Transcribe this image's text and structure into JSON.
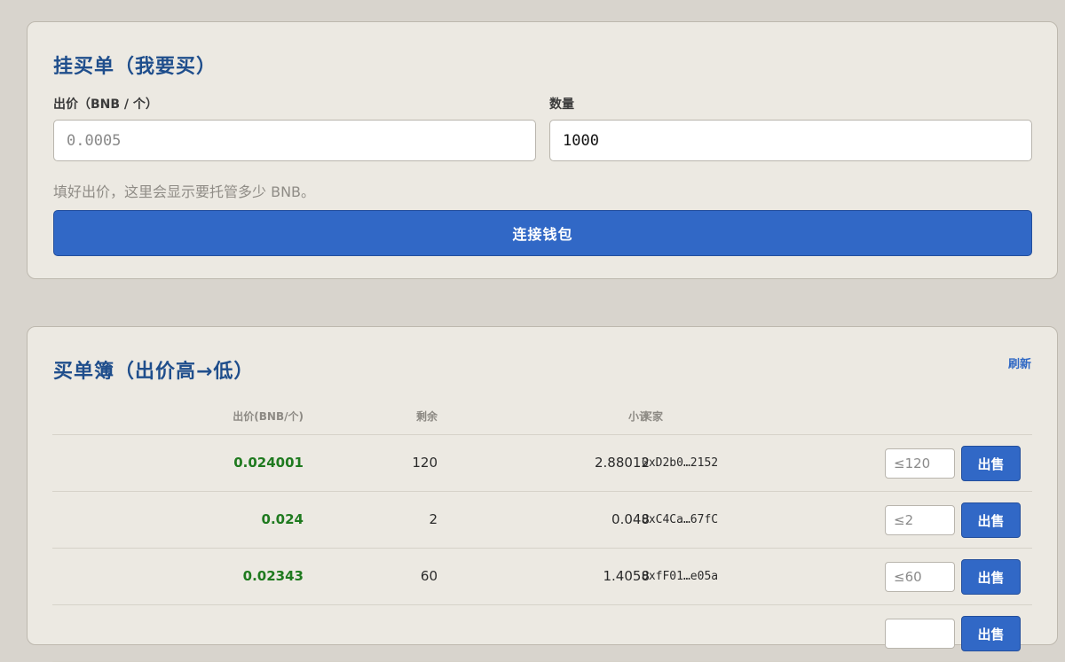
{
  "buy_order": {
    "title": "挂买单（我要买）",
    "price_label": "出价（BNB / 个）",
    "price_placeholder": "0.0005",
    "price_value": "",
    "qty_label": "数量",
    "qty_value": "1000",
    "hint": "填好出价，这里会显示要托管多少 BNB。",
    "connect_label": "连接钱包"
  },
  "order_book": {
    "title": "买单簿（出价高→低）",
    "refresh_label": "刷新",
    "columns": {
      "price": "出价(BNB/个)",
      "remaining": "剩余",
      "subtotal": "小计",
      "buyer": "买家"
    },
    "rows": [
      {
        "price": "0.024001",
        "remaining": "120",
        "subtotal": "2.88012",
        "buyer": "0xD2b0…2152",
        "sell_placeholder": "≤120",
        "sell_label": "出售"
      },
      {
        "price": "0.024",
        "remaining": "2",
        "subtotal": "0.048",
        "buyer": "0xC4Ca…67fC",
        "sell_placeholder": "≤2",
        "sell_label": "出售"
      },
      {
        "price": "0.02343",
        "remaining": "60",
        "subtotal": "1.4058",
        "buyer": "0xfF01…e05a",
        "sell_placeholder": "≤60",
        "sell_label": "出售"
      },
      {
        "price": "",
        "remaining": "",
        "subtotal": "",
        "buyer": "",
        "sell_placeholder": "",
        "sell_label": "出售"
      }
    ]
  },
  "colors": {
    "accent": "#3168c6",
    "title": "#1f4e8c",
    "price_green": "#1f7a1f",
    "card_bg": "#ece9e2",
    "page_bg": "#d8d4cd"
  }
}
